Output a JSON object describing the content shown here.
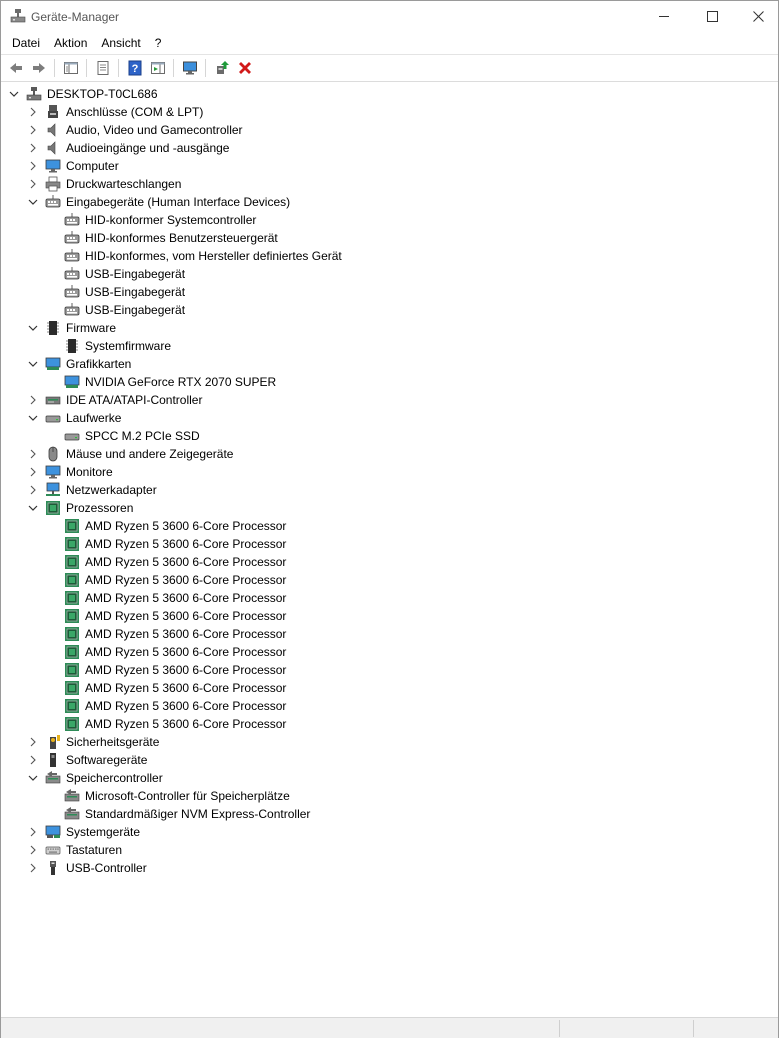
{
  "window": {
    "title": "Geräte-Manager",
    "buttons": {
      "minimize": "minimize-icon",
      "maximize": "maximize-icon",
      "close": "close-icon"
    }
  },
  "menu": [
    "Datei",
    "Aktion",
    "Ansicht",
    "?"
  ],
  "toolbar": [
    {
      "name": "back-button",
      "icon": "arrow-left-icon"
    },
    {
      "name": "forward-button",
      "icon": "arrow-right-icon"
    },
    {
      "sep": true
    },
    {
      "name": "show-hide-console-tree-button",
      "icon": "console-tree-icon"
    },
    {
      "sep": true
    },
    {
      "name": "properties-button",
      "icon": "properties-icon"
    },
    {
      "sep": true
    },
    {
      "name": "help-button",
      "icon": "help-icon"
    },
    {
      "name": "action-pane-button",
      "icon": "action-pane-icon"
    },
    {
      "sep": true
    },
    {
      "name": "scan-hardware-button",
      "icon": "monitor-scan-icon"
    },
    {
      "sep": true
    },
    {
      "name": "update-driver-button",
      "icon": "update-driver-icon"
    },
    {
      "name": "uninstall-device-button",
      "icon": "red-x-icon"
    }
  ],
  "tree": [
    {
      "level": 0,
      "label": "DESKTOP-T0CL686",
      "icon": "pc",
      "state": "open"
    },
    {
      "level": 1,
      "label": "Anschlüsse (COM & LPT)",
      "icon": "port",
      "state": "closed"
    },
    {
      "level": 1,
      "label": "Audio, Video und Gamecontroller",
      "icon": "speaker",
      "state": "closed"
    },
    {
      "level": 1,
      "label": "Audioeingänge und -ausgänge",
      "icon": "speaker",
      "state": "closed"
    },
    {
      "level": 1,
      "label": "Computer",
      "icon": "monitor",
      "state": "closed"
    },
    {
      "level": 1,
      "label": "Druckwarteschlangen",
      "icon": "printer",
      "state": "closed"
    },
    {
      "level": 1,
      "label": "Eingabegeräte (Human Interface Devices)",
      "icon": "hid",
      "state": "open"
    },
    {
      "level": 2,
      "label": "HID-konformer Systemcontroller",
      "icon": "hid"
    },
    {
      "level": 2,
      "label": "HID-konformes Benutzersteuergerät",
      "icon": "hid"
    },
    {
      "level": 2,
      "label": "HID-konformes, vom Hersteller definiertes Gerät",
      "icon": "hid"
    },
    {
      "level": 2,
      "label": "USB-Eingabegerät",
      "icon": "hid"
    },
    {
      "level": 2,
      "label": "USB-Eingabegerät",
      "icon": "hid"
    },
    {
      "level": 2,
      "label": "USB-Eingabegerät",
      "icon": "hid"
    },
    {
      "level": 1,
      "label": "Firmware",
      "icon": "chip",
      "state": "open"
    },
    {
      "level": 2,
      "label": "Systemfirmware",
      "icon": "chip"
    },
    {
      "level": 1,
      "label": "Grafikkarten",
      "icon": "display",
      "state": "open"
    },
    {
      "level": 2,
      "label": "NVIDIA GeForce RTX 2070 SUPER",
      "icon": "display"
    },
    {
      "level": 1,
      "label": "IDE ATA/ATAPI-Controller",
      "icon": "ide",
      "state": "closed"
    },
    {
      "level": 1,
      "label": "Laufwerke",
      "icon": "drive",
      "state": "open"
    },
    {
      "level": 2,
      "label": "SPCC M.2 PCIe SSD",
      "icon": "drive"
    },
    {
      "level": 1,
      "label": "Mäuse und andere Zeigegeräte",
      "icon": "mouse",
      "state": "closed"
    },
    {
      "level": 1,
      "label": "Monitore",
      "icon": "monitor",
      "state": "closed"
    },
    {
      "level": 1,
      "label": "Netzwerkadapter",
      "icon": "network",
      "state": "closed"
    },
    {
      "level": 1,
      "label": "Prozessoren",
      "icon": "cpu",
      "state": "open"
    },
    {
      "level": 2,
      "label": "AMD Ryzen 5 3600 6-Core Processor",
      "icon": "cpu"
    },
    {
      "level": 2,
      "label": "AMD Ryzen 5 3600 6-Core Processor",
      "icon": "cpu"
    },
    {
      "level": 2,
      "label": "AMD Ryzen 5 3600 6-Core Processor",
      "icon": "cpu"
    },
    {
      "level": 2,
      "label": "AMD Ryzen 5 3600 6-Core Processor",
      "icon": "cpu"
    },
    {
      "level": 2,
      "label": "AMD Ryzen 5 3600 6-Core Processor",
      "icon": "cpu"
    },
    {
      "level": 2,
      "label": "AMD Ryzen 5 3600 6-Core Processor",
      "icon": "cpu"
    },
    {
      "level": 2,
      "label": "AMD Ryzen 5 3600 6-Core Processor",
      "icon": "cpu"
    },
    {
      "level": 2,
      "label": "AMD Ryzen 5 3600 6-Core Processor",
      "icon": "cpu"
    },
    {
      "level": 2,
      "label": "AMD Ryzen 5 3600 6-Core Processor",
      "icon": "cpu"
    },
    {
      "level": 2,
      "label": "AMD Ryzen 5 3600 6-Core Processor",
      "icon": "cpu"
    },
    {
      "level": 2,
      "label": "AMD Ryzen 5 3600 6-Core Processor",
      "icon": "cpu"
    },
    {
      "level": 2,
      "label": "AMD Ryzen 5 3600 6-Core Processor",
      "icon": "cpu"
    },
    {
      "level": 1,
      "label": "Sicherheitsgeräte",
      "icon": "security",
      "state": "closed"
    },
    {
      "level": 1,
      "label": "Softwaregeräte",
      "icon": "software",
      "state": "closed"
    },
    {
      "level": 1,
      "label": "Speichercontroller",
      "icon": "storage",
      "state": "open"
    },
    {
      "level": 2,
      "label": "Microsoft-Controller für Speicherplätze",
      "icon": "storage"
    },
    {
      "level": 2,
      "label": "Standardmäßiger NVM Express-Controller",
      "icon": "storage"
    },
    {
      "level": 1,
      "label": "Systemgeräte",
      "icon": "system",
      "state": "closed"
    },
    {
      "level": 1,
      "label": "Tastaturen",
      "icon": "keyboard",
      "state": "closed"
    },
    {
      "level": 1,
      "label": "USB-Controller",
      "icon": "usb",
      "state": "closed"
    }
  ],
  "colors": {
    "accent": "#1a7fd4",
    "cpu_green": "#2e8b57",
    "close_red": "#d11a1a",
    "update_green": "#1f9a3a"
  }
}
